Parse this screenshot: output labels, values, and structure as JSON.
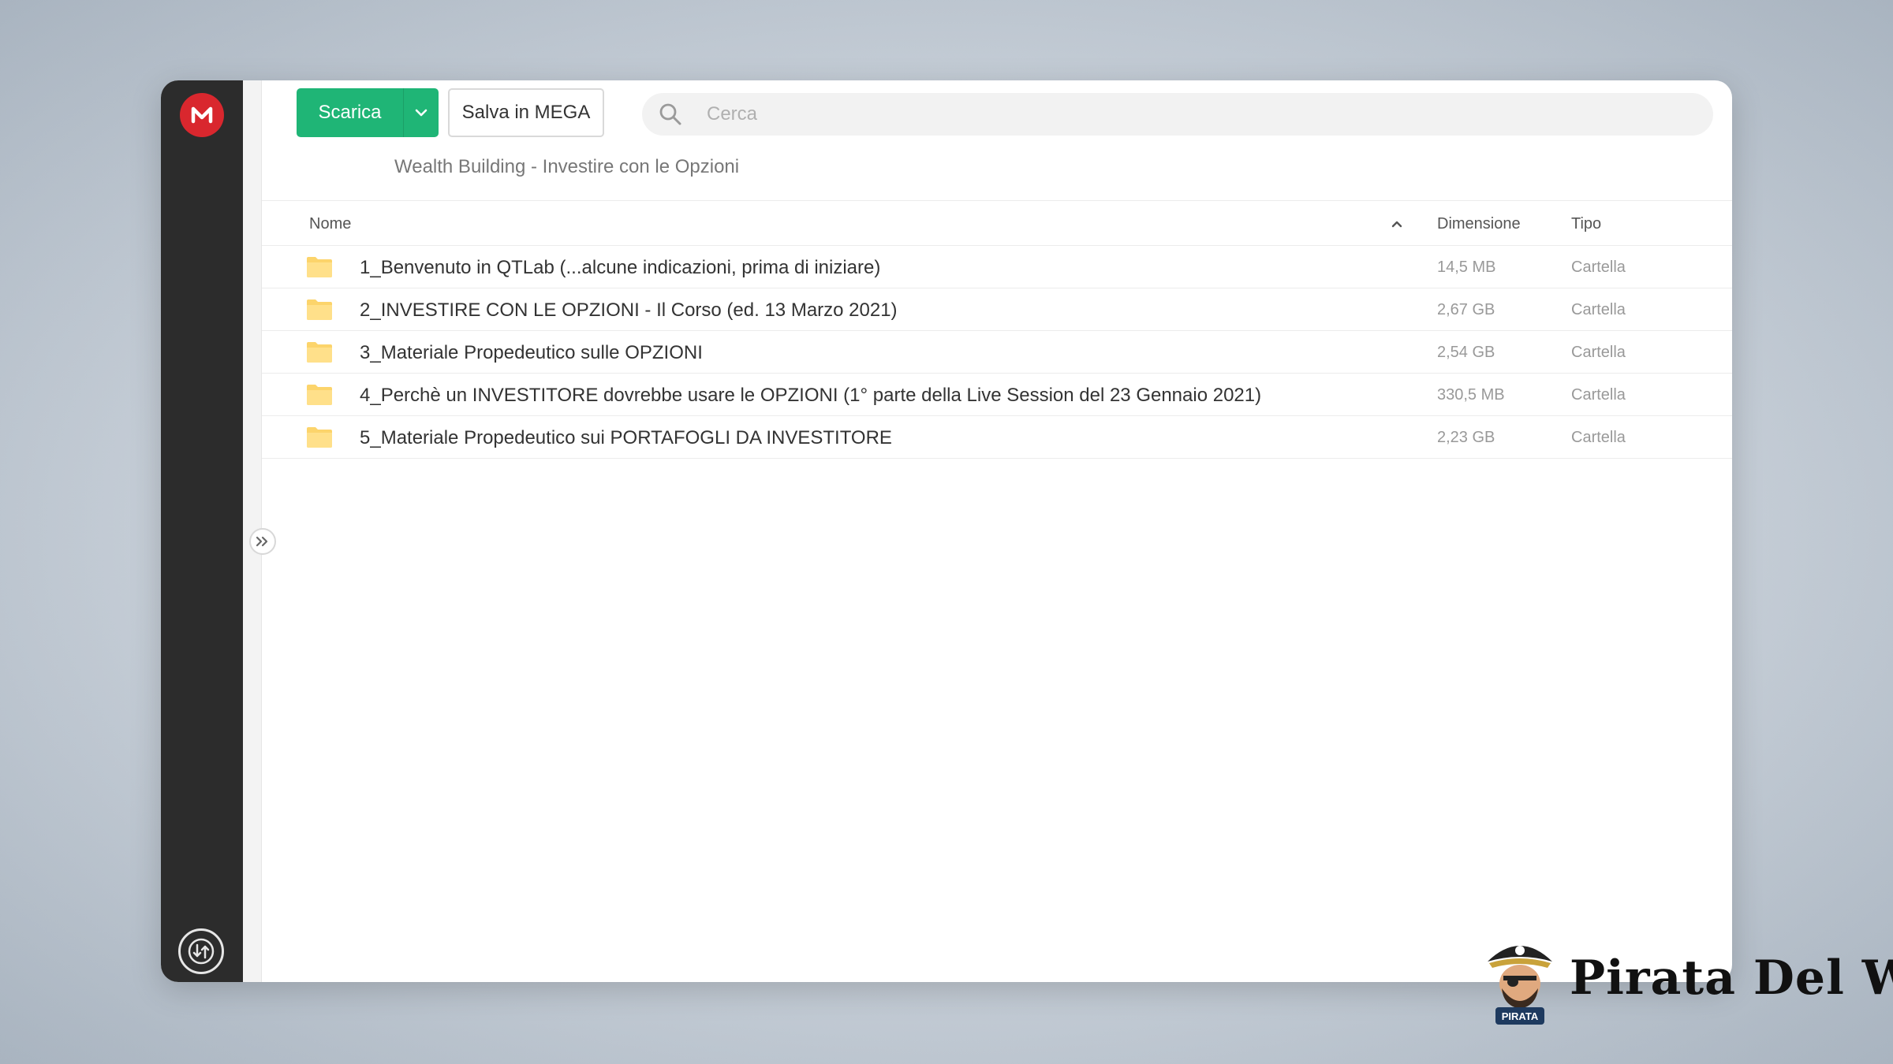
{
  "app": {
    "logo_letter": "M",
    "accent_color": "#d9272e",
    "primary_color": "#1fb576"
  },
  "toolbar": {
    "download_label": "Scarica",
    "save_label": "Salva in MEGA",
    "search_placeholder": "Cerca"
  },
  "breadcrumb": "Wealth Building - Investire con le Opzioni",
  "table": {
    "headers": {
      "name": "Nome",
      "size": "Dimensione",
      "type": "Tipo"
    },
    "rows": [
      {
        "name": "1_Benvenuto in QTLab (...alcune indicazioni, prima di iniziare)",
        "size": "14,5 MB",
        "type": "Cartella"
      },
      {
        "name": "2_INVESTIRE CON LE OPZIONI - Il Corso (ed. 13 Marzo 2021)",
        "size": "2,67 GB",
        "type": "Cartella"
      },
      {
        "name": "3_Materiale Propedeutico sulle OPZIONI",
        "size": "2,54 GB",
        "type": "Cartella"
      },
      {
        "name": "4_Perchè un INVESTITORE dovrebbe usare le OPZIONI (1° parte della Live Session del 23 Gennaio 2021)",
        "size": "330,5 MB",
        "type": "Cartella"
      },
      {
        "name": "5_Materiale Propedeutico sui PORTAFOGLI DA INVESTITORE",
        "size": "2,23 GB",
        "type": "Cartella"
      }
    ]
  },
  "watermark": {
    "brand_name": "Pirata Del Web",
    "mascot_label": "PIRATA"
  }
}
